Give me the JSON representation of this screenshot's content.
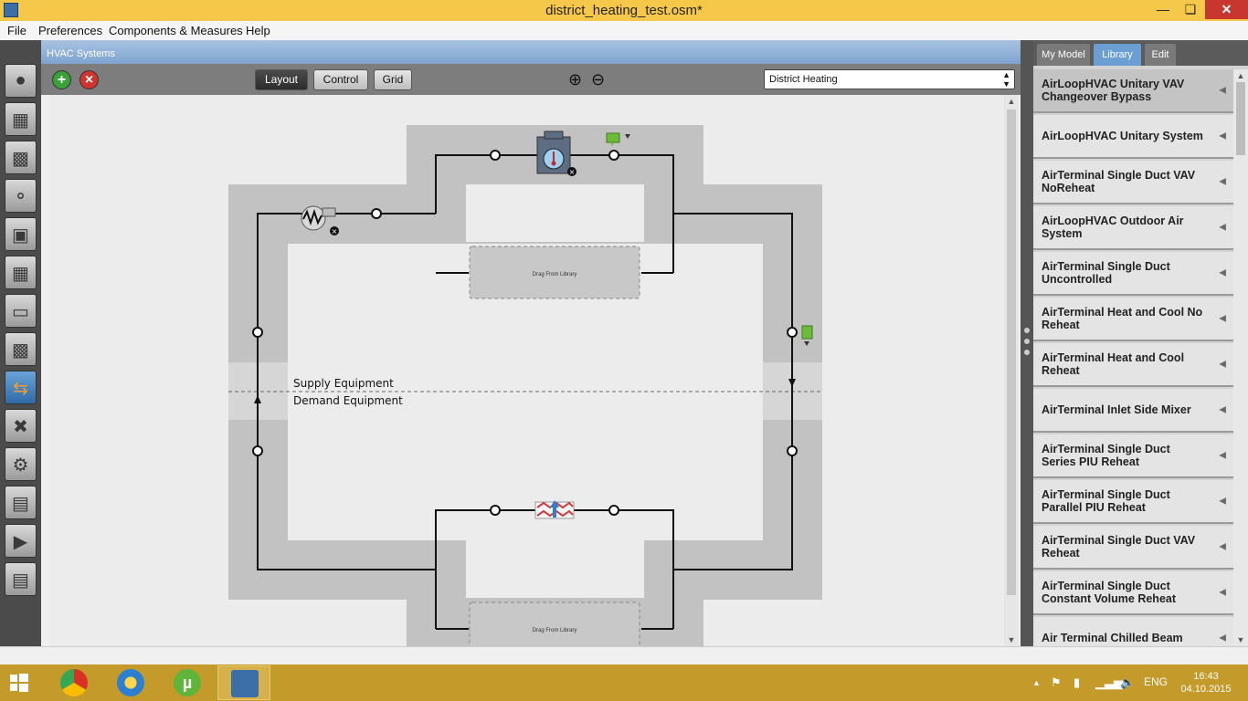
{
  "window": {
    "title": "district_heating_test.osm*"
  },
  "menu": [
    "File",
    "Preferences",
    "Components & Measures",
    "Help"
  ],
  "left_tools": [
    "site-icon",
    "schedules-icon",
    "constructions-icon",
    "loads-icon",
    "space-types-icon",
    "geometry-icon",
    "facility-icon",
    "spaces-icon",
    "hvac-systems-icon",
    "building-summary-icon",
    "measures-icon",
    "simulation-settings-icon",
    "scripts-icon",
    "run-icon",
    "results-icon"
  ],
  "hvac": {
    "header": "HVAC Systems",
    "view_buttons": {
      "layout": "Layout",
      "control": "Control",
      "grid": "Grid"
    },
    "selected_loop": "District Heating",
    "labels": {
      "supply": "Supply Equipment",
      "demand": "Demand Equipment",
      "drag_top": "Drag From Library",
      "drag_bottom": "Drag From Library"
    }
  },
  "right_panel": {
    "tabs": [
      "My Model",
      "Library",
      "Edit"
    ],
    "selected_tab": "Library",
    "items": [
      "AirLoopHVAC Unitary VAV Changeover Bypass",
      "AirLoopHVAC Unitary System",
      "AirTerminal Single Duct VAV NoReheat",
      "AirLoopHVAC Outdoor Air System",
      "AirTerminal Single Duct Uncontrolled",
      "AirTerminal Heat and Cool No Reheat",
      "AirTerminal Heat and Cool Reheat",
      "AirTerminal Inlet Side Mixer",
      "AirTerminal Single Duct Series PIU Reheat",
      "AirTerminal Single Duct Parallel PIU Reheat",
      "AirTerminal Single Duct VAV Reheat",
      "AirTerminal Single Duct Constant Volume Reheat",
      "Air Terminal Chilled Beam"
    ]
  },
  "taskbar": {
    "apps": [
      "chrome-icon",
      "gateway-icon",
      "utorrent-icon",
      "openstudio-icon"
    ],
    "tray": {
      "lang": "ENG",
      "time": "16:43",
      "date": "04.10.2015"
    }
  },
  "colors": {
    "titlebar": "#f6c84a",
    "taskbar": "#c49a2a",
    "accent": "#6b9fd4",
    "loop_band": "#c2c2c2"
  }
}
